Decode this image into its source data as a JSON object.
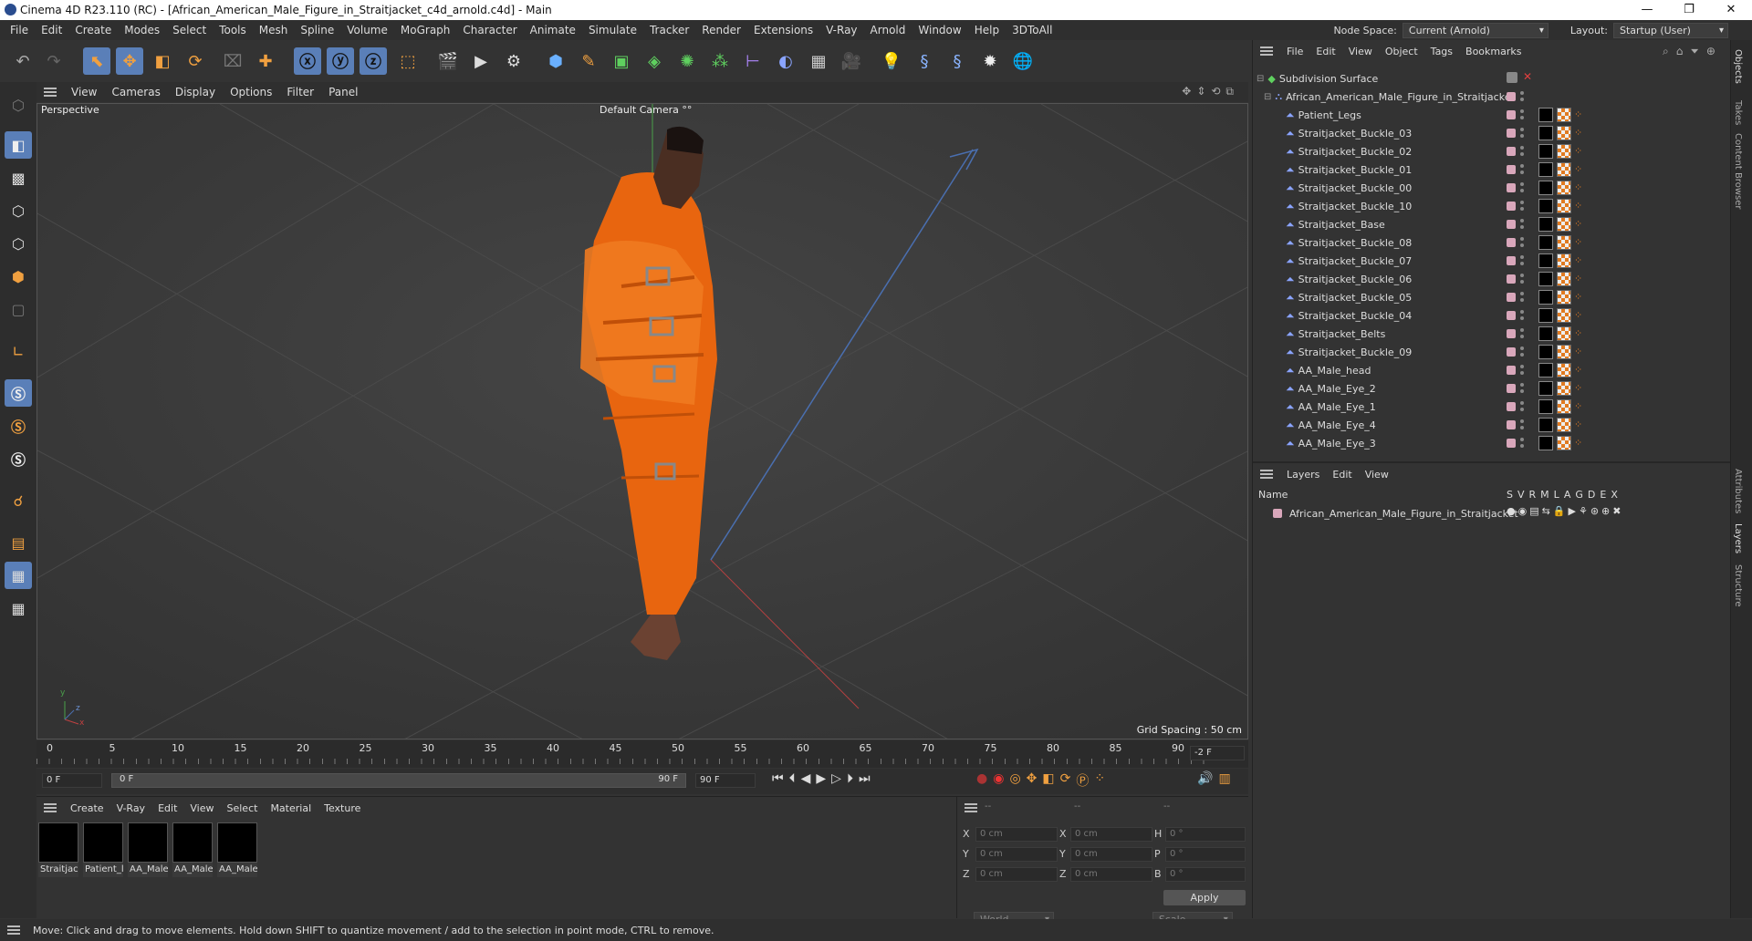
{
  "window": {
    "title": "Cinema 4D R23.110 (RC) - [African_American_Male_Figure_in_Straitjacket_c4d_arnold.c4d] - Main",
    "controls": [
      "—",
      "❐",
      "✕"
    ]
  },
  "menubar": {
    "items": [
      "File",
      "Edit",
      "Create",
      "Modes",
      "Select",
      "Tools",
      "Mesh",
      "Spline",
      "Volume",
      "MoGraph",
      "Character",
      "Animate",
      "Simulate",
      "Tracker",
      "Render",
      "Extensions",
      "V-Ray",
      "Arnold",
      "Window",
      "Help",
      "3DToAll"
    ],
    "node_space_label": "Node Space:",
    "node_space_value": "Current (Arnold)",
    "layout_label": "Layout:",
    "layout_value": "Startup (User)"
  },
  "viewport": {
    "menu": [
      "View",
      "Cameras",
      "Display",
      "Options",
      "Filter",
      "Panel"
    ],
    "view_name": "Perspective",
    "camera_name": "Default Camera",
    "camera_suffix": "°°",
    "grid_spacing": "Grid Spacing : 50 cm",
    "axis_y": "y",
    "axis_x": "x",
    "axis_z": "z"
  },
  "timeline": {
    "ticks": [
      "0",
      "5",
      "10",
      "15",
      "20",
      "25",
      "30",
      "35",
      "40",
      "45",
      "50",
      "55",
      "60",
      "65",
      "70",
      "75",
      "80",
      "85",
      "90"
    ],
    "current_frame": "-2 F",
    "start_field": "0 F",
    "range_start": "0 F",
    "range_end": "90 F",
    "end_field": "90 F"
  },
  "material_manager": {
    "menu": [
      "Create",
      "V-Ray",
      "Edit",
      "View",
      "Select",
      "Material",
      "Texture"
    ],
    "materials": [
      "Straitjack",
      "Patient_l",
      "AA_Male",
      "AA_Male",
      "AA_Male"
    ]
  },
  "coords": {
    "header": [
      "--",
      "--",
      "--"
    ],
    "rows": [
      {
        "a": "X",
        "av": "0 cm",
        "b": "X",
        "bv": "0 cm",
        "c": "H",
        "cv": "0 °"
      },
      {
        "a": "Y",
        "av": "0 cm",
        "b": "Y",
        "bv": "0 cm",
        "c": "P",
        "cv": "0 °"
      },
      {
        "a": "Z",
        "av": "0 cm",
        "b": "Z",
        "bv": "0 cm",
        "c": "B",
        "cv": "0 °"
      }
    ],
    "world": "World",
    "scale": "Scale",
    "apply": "Apply"
  },
  "object_manager": {
    "menu": [
      "File",
      "Edit",
      "View",
      "Object",
      "Tags",
      "Bookmarks"
    ],
    "root": "Subdivision Surface",
    "group": "African_American_Male_Figure_in_Straitjacket",
    "objects": [
      "Patient_Legs",
      "Straitjacket_Buckle_03",
      "Straitjacket_Buckle_02",
      "Straitjacket_Buckle_01",
      "Straitjacket_Buckle_00",
      "Straitjacket_Buckle_10",
      "Straitjacket_Base",
      "Straitjacket_Buckle_08",
      "Straitjacket_Buckle_07",
      "Straitjacket_Buckle_06",
      "Straitjacket_Buckle_05",
      "Straitjacket_Buckle_04",
      "Straitjacket_Belts",
      "Straitjacket_Buckle_09",
      "AA_Male_head",
      "AA_Male_Eye_2",
      "AA_Male_Eye_1",
      "AA_Male_Eye_4",
      "AA_Male_Eye_3"
    ]
  },
  "layer_manager": {
    "menu": [
      "Layers",
      "Edit",
      "View"
    ],
    "name_header": "Name",
    "col_headers": [
      "S",
      "V",
      "R",
      "M",
      "L",
      "A",
      "G",
      "D",
      "E",
      "X"
    ],
    "layer_name": "African_American_Male_Figure_in_Straitjacket",
    "layer_color": "#d9a7bb"
  },
  "right_tabs": [
    "Objects",
    "Takes",
    "Content Browser",
    "Attributes",
    "Layers",
    "Structure"
  ],
  "status": "Move: Click and drag to move elements. Hold down SHIFT to quantize movement / add to the selection in point mode, CTRL to remove.",
  "colors": {
    "accent": "#e07a20",
    "ui_bg": "#333333",
    "tool_blue": "#5a7fb8"
  }
}
